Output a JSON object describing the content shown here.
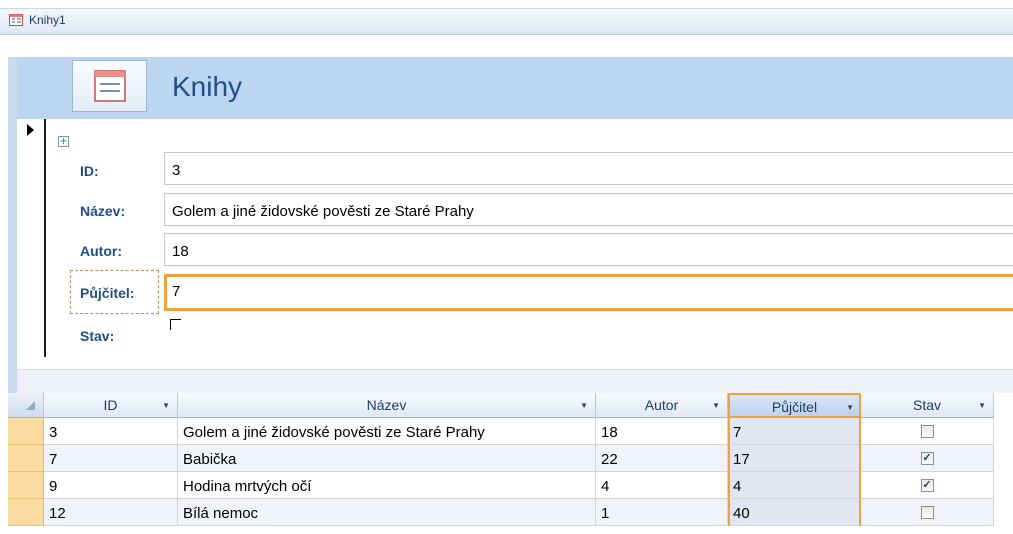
{
  "window": {
    "title": "Knihy1"
  },
  "form": {
    "title": "Knihy",
    "fields": {
      "id": {
        "label": "ID:",
        "value": "3"
      },
      "nazev": {
        "label": "Název:",
        "value": "Golem a jiné židovské pověsti ze Staré Prahy"
      },
      "autor": {
        "label": "Autor:",
        "value": "18"
      },
      "pujcitel": {
        "label": "Půjčitel:",
        "value": "7"
      },
      "stav": {
        "label": "Stav:",
        "checked": false
      }
    }
  },
  "datasheet": {
    "columns": [
      "ID",
      "Název",
      "Autor",
      "Půjčitel",
      "Stav"
    ],
    "rows": [
      {
        "id": "3",
        "nazev": "Golem a jiné židovské pověsti ze Staré Prahy",
        "autor": "18",
        "pujcitel": "7",
        "stav": false
      },
      {
        "id": "7",
        "nazev": "Babička",
        "autor": "22",
        "pujcitel": "17",
        "stav": true
      },
      {
        "id": "9",
        "nazev": "Hodina mrtvých očí",
        "autor": "4",
        "pujcitel": "4",
        "stav": true
      },
      {
        "id": "12",
        "nazev": "Bílá nemoc",
        "autor": "1",
        "pujcitel": "40",
        "stav": false
      }
    ]
  },
  "icons": {
    "form": "form-icon",
    "record_arrow": "record-pointer-icon",
    "move": "move-handle-icon",
    "dropdown": "dropdown-arrow-icon"
  },
  "colors": {
    "accent": "#f0a040",
    "header_band": "#bcd5f1",
    "title_text": "#1f4f8a",
    "row_selector": "#fbdca0"
  }
}
